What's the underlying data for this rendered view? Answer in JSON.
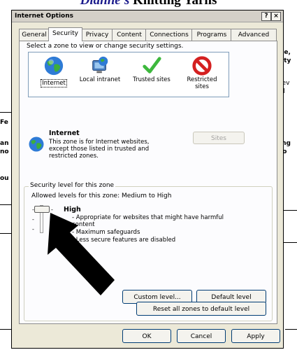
{
  "background_page": {
    "title_em": "Dianne's",
    "title_rest": " Knitting Yarns",
    "right_fragments": [
      "ne,",
      "lity",
      "tev",
      "al",
      "ing",
      "to"
    ],
    "left_fragments": [
      "Fe",
      "an",
      "no",
      "ou"
    ]
  },
  "dialog": {
    "title": "Internet Options",
    "help_button": "?",
    "close_button": "×",
    "tabs": [
      "General",
      "Security",
      "Privacy",
      "Content",
      "Connections",
      "Programs",
      "Advanced"
    ],
    "active_tab": "Security",
    "instruction": "Select a zone to view or change security settings.",
    "zones": [
      {
        "label": "Internet",
        "icon": "globe-icon",
        "selected": true
      },
      {
        "label": "Local intranet",
        "icon": "monitor-globe-icon",
        "selected": false
      },
      {
        "label": "Trusted sites",
        "icon": "checkmark-icon",
        "selected": false
      },
      {
        "label": "Restricted sites",
        "icon": "no-entry-icon",
        "selected": false
      }
    ],
    "zone_info": {
      "heading": "Internet",
      "description": "This zone is for Internet websites, except those listed in trusted and restricted zones.",
      "sites_button": "Sites"
    },
    "security_level": {
      "group_title": "Security level for this zone",
      "allowed_levels": "Allowed levels for this zone: Medium to High",
      "level_name": "High",
      "bullets": [
        "- Appropriate for websites that might have harmful content",
        "- Maximum safeguards",
        "- Less secure features are disabled"
      ],
      "custom_level_button": "Custom level...",
      "default_level_button": "Default level"
    },
    "reset_all_button": "Reset all zones to default level",
    "footer": {
      "ok": "OK",
      "cancel": "Cancel",
      "apply": "Apply"
    },
    "colors": {
      "dialog_bg": "#ece9d8",
      "panel_bg": "#fcfcfe",
      "button_border": "#003c74"
    }
  }
}
